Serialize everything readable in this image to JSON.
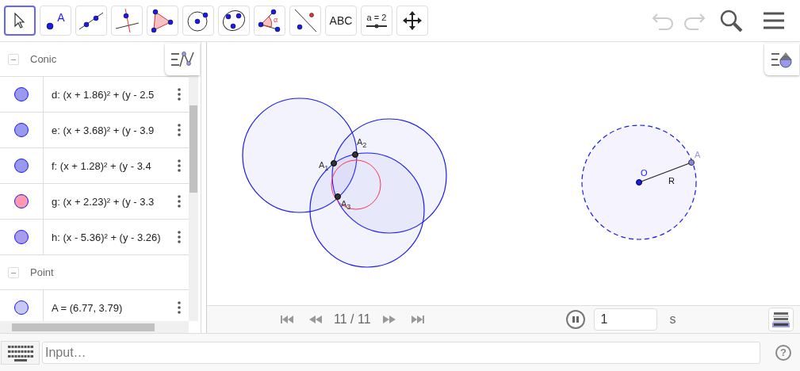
{
  "toolbar": {
    "tools": [
      {
        "kind": "move",
        "selected": true
      },
      {
        "kind": "point",
        "label": "A",
        "selected": false
      },
      {
        "kind": "line",
        "selected": false
      },
      {
        "kind": "perpendicular",
        "selected": false
      },
      {
        "kind": "polygon",
        "selected": false
      },
      {
        "kind": "circle",
        "selected": false
      },
      {
        "kind": "conic",
        "selected": false
      },
      {
        "kind": "angle",
        "label": "α",
        "selected": false
      },
      {
        "kind": "reflect",
        "selected": false
      },
      {
        "kind": "text",
        "label": "ABC",
        "selected": false
      },
      {
        "kind": "slider",
        "label": "a = 2",
        "selected": false
      },
      {
        "kind": "pan",
        "selected": false
      }
    ],
    "undo": {
      "disabled": true
    },
    "redo": {
      "disabled": true
    }
  },
  "algebra": {
    "groups": [
      {
        "title": "Conic",
        "expanded": true,
        "items": [
          {
            "text": "d: (x + 1.86)² + (y - 2.5",
            "color": "#9999ee"
          },
          {
            "text": "e: (x + 3.68)² + (y - 3.9",
            "color": "#9999ee"
          },
          {
            "text": "f: (x + 1.28)² + (y - 3.4",
            "color": "#9999ee"
          },
          {
            "text": "g: (x + 2.23)² + (y - 3.3",
            "color": "#ff99b0"
          },
          {
            "text": "h: (x - 5.36)² + (y - 3.26)",
            "color": "#a99cec"
          }
        ]
      },
      {
        "title": "Point",
        "expanded": true,
        "items": [
          {
            "text": "A = (6.77, 3.79)",
            "color": "#c8c8f4"
          }
        ]
      }
    ]
  },
  "graphics": {
    "labels": [
      {
        "kind": "point",
        "text": "A$_{1}$"
      },
      {
        "kind": "point",
        "text": "A$_{2}$"
      },
      {
        "kind": "point",
        "text": "A$_{3}$"
      },
      {
        "kind": "center",
        "text": "O"
      },
      {
        "kind": "segment",
        "text": "R"
      },
      {
        "kind": "free",
        "text": "A"
      }
    ]
  },
  "playbar": {
    "position": "11 / 11",
    "playing": true,
    "step": "1",
    "unit": "s"
  },
  "input": {
    "placeholder": "Input…",
    "help": "?"
  }
}
